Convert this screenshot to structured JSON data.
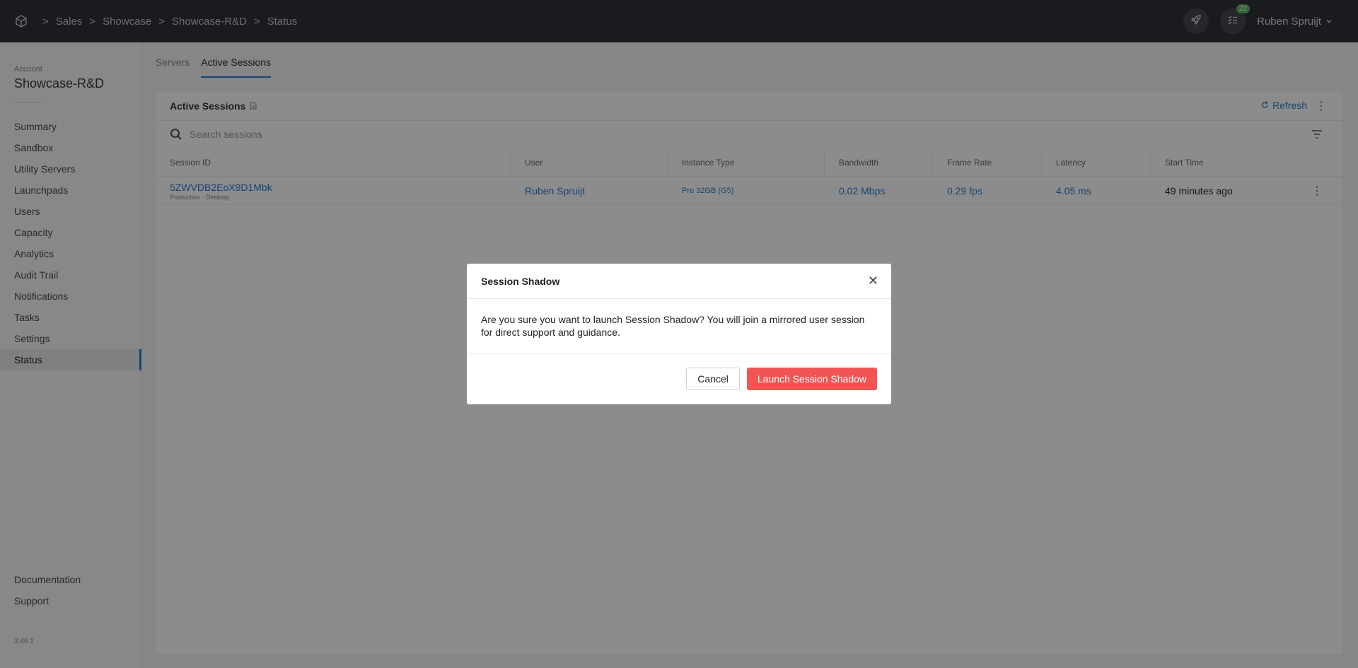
{
  "breadcrumb": [
    "Sales",
    "Showcase",
    "Showcase-R&D",
    "Status"
  ],
  "breadcrumb_sep": ">",
  "topbar": {
    "notification_count": "22",
    "user_name": "Ruben Spruijt"
  },
  "sidebar": {
    "account_label": "Account",
    "account_name": "Showcase-R&D",
    "items": [
      "Summary",
      "Sandbox",
      "Utility Servers",
      "Launchpads",
      "Users",
      "Capacity",
      "Analytics",
      "Audit Trail",
      "Notifications",
      "Tasks",
      "Settings",
      "Status"
    ],
    "active_item": "Status",
    "bottom_items": [
      "Documentation",
      "Support"
    ],
    "version": "3.46.1"
  },
  "tabs": [
    "Servers",
    "Active Sessions"
  ],
  "active_tab": "Active Sessions",
  "panel": {
    "title": "Active Sessions",
    "refresh_label": "Refresh",
    "search_placeholder": "Search sessions"
  },
  "table": {
    "columns": [
      "Session ID",
      "User",
      "Instance Type",
      "Bandwidth",
      "Frame Rate",
      "Latency",
      "Start Time"
    ],
    "rows": [
      {
        "session_id": "5ZWVDB2EoX9D1Mbk",
        "tags": "Production · Desktop",
        "user": "Ruben Spruijt",
        "instance_type": "Pro 32GB (G5)",
        "bandwidth": "0.02 Mbps",
        "frame_rate": "0.29 fps",
        "latency": "4.05 ms",
        "start_time": "49 minutes ago"
      }
    ]
  },
  "modal": {
    "title": "Session Shadow",
    "body": "Are you sure you want to launch Session Shadow? You will join a mirrored user session for direct support and guidance.",
    "cancel_label": "Cancel",
    "confirm_label": "Launch Session Shadow"
  },
  "colors": {
    "topbar": "#2f3237",
    "accent": "#2a7fcf",
    "danger": "#f25454",
    "badge": "#5fb55f"
  }
}
